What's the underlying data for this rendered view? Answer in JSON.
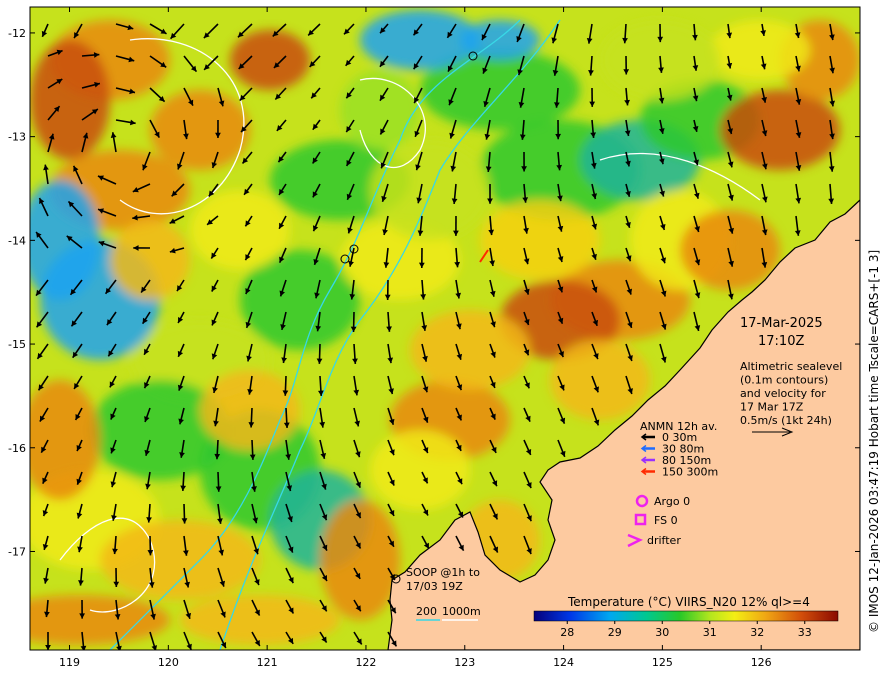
{
  "map": {
    "x_ticks": [
      "119",
      "120",
      "121",
      "122",
      "123",
      "124",
      "125",
      "126"
    ],
    "y_ticks": [
      "-12",
      "-13",
      "-14",
      "-15",
      "-16",
      "-17"
    ],
    "x_range": [
      118.6,
      127.0
    ],
    "y_range": [
      -17.95,
      -11.75
    ],
    "colors": {
      "land": "#fdcaa0",
      "coast": "#000000",
      "contour_200": "#38d8e6",
      "contour_1000": "#ffffff",
      "vector": "#000000",
      "magenta": "#ee22ee"
    }
  },
  "date": {
    "day": "17-Mar-2025",
    "time": "17:10Z"
  },
  "altimetry": {
    "lines": [
      "Altimetric sealevel",
      "(0.1m contours)",
      "and velocity for",
      "17 Mar 17Z",
      "0.5m/s (1kt 24h)"
    ]
  },
  "anmn": {
    "title": "ANMN 12h av.",
    "items": [
      {
        "label": "0 30m",
        "color": "#000000"
      },
      {
        "label": "30 80m",
        "color": "#1e6cff"
      },
      {
        "label": "80 150m",
        "color": "#9a30ff"
      },
      {
        "label": "150 300m",
        "color": "#ff2a00"
      }
    ]
  },
  "markers": {
    "argo": "Argo 0",
    "fs": "FS 0",
    "drifter": "drifter"
  },
  "soop": {
    "line1": "SOOP @1h to",
    "line2": "17/03 19Z"
  },
  "depth_legend": {
    "a": "200",
    "b": "1000m"
  },
  "colorbar": {
    "title": "Temperature (°C) VIIRS_N20 12% ql>=4",
    "ticks": [
      "28",
      "29",
      "30",
      "31",
      "32",
      "33"
    ],
    "min": 27.3,
    "max": 33.7
  },
  "credit": "© IMOS 12-Jan-2026 03:47:19 Hobart time Tscale=CARS+[-1 3]"
}
